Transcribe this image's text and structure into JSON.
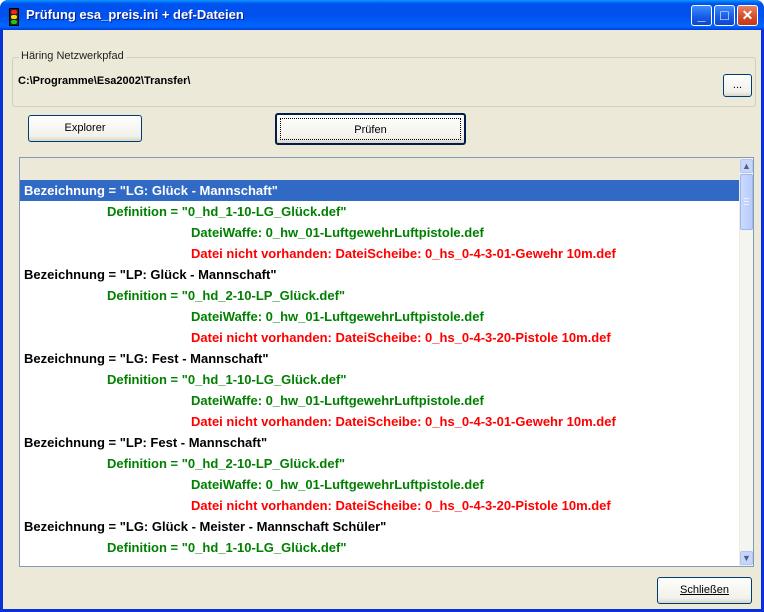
{
  "window": {
    "title": "Prüfung esa_preis.ini + def-Dateien"
  },
  "titlebar_buttons": {
    "minimize": "_",
    "maximize": "□",
    "close": "✕"
  },
  "path_group": {
    "legend": "Häring Netzwerkpfad",
    "path": "C:\\Programme\\Esa2002\\Transfer\\",
    "browse_label": "..."
  },
  "buttons": {
    "explorer": "Explorer",
    "pruefen": "Prüfen",
    "schliessen": "Schließen"
  },
  "list": {
    "selected_index": 0,
    "rows": [
      {
        "level": 0,
        "type": "bezeichnung",
        "text": "Bezeichnung = \"LG: Glück - Mannschaft\""
      },
      {
        "level": 1,
        "type": "definition",
        "text": "Definition = \"0_hd_1-10-LG_Glück.def\""
      },
      {
        "level": 2,
        "type": "ok",
        "text": "DateiWaffe: 0_hw_01-LuftgewehrLuftpistole.def"
      },
      {
        "level": 2,
        "type": "error",
        "text": "Datei nicht vorhanden: DateiScheibe: 0_hs_0-4-3-01-Gewehr 10m.def"
      },
      {
        "level": 0,
        "type": "bezeichnung",
        "text": "Bezeichnung = \"LP: Glück - Mannschaft\""
      },
      {
        "level": 1,
        "type": "definition",
        "text": "Definition = \"0_hd_2-10-LP_Glück.def\""
      },
      {
        "level": 2,
        "type": "ok",
        "text": "DateiWaffe: 0_hw_01-LuftgewehrLuftpistole.def"
      },
      {
        "level": 2,
        "type": "error",
        "text": "Datei nicht vorhanden: DateiScheibe: 0_hs_0-4-3-20-Pistole 10m.def"
      },
      {
        "level": 0,
        "type": "bezeichnung",
        "text": "Bezeichnung = \"LG: Fest - Mannschaft\""
      },
      {
        "level": 1,
        "type": "definition",
        "text": "Definition = \"0_hd_1-10-LG_Glück.def\""
      },
      {
        "level": 2,
        "type": "ok",
        "text": "DateiWaffe: 0_hw_01-LuftgewehrLuftpistole.def"
      },
      {
        "level": 2,
        "type": "error",
        "text": "Datei nicht vorhanden: DateiScheibe: 0_hs_0-4-3-01-Gewehr 10m.def"
      },
      {
        "level": 0,
        "type": "bezeichnung",
        "text": "Bezeichnung = \"LP: Fest - Mannschaft\""
      },
      {
        "level": 1,
        "type": "definition",
        "text": "Definition = \"0_hd_2-10-LP_Glück.def\""
      },
      {
        "level": 2,
        "type": "ok",
        "text": "DateiWaffe: 0_hw_01-LuftgewehrLuftpistole.def"
      },
      {
        "level": 2,
        "type": "error",
        "text": "Datei nicht vorhanden: DateiScheibe: 0_hs_0-4-3-20-Pistole 10m.def"
      },
      {
        "level": 0,
        "type": "bezeichnung",
        "text": "Bezeichnung = \"LG: Glück - Meister - Mannschaft Schüler\""
      },
      {
        "level": 1,
        "type": "definition",
        "text": "Definition = \"0_hd_1-10-LG_Glück.def\""
      }
    ]
  },
  "scrollbar": {
    "up_icon": "chevron-up-icon",
    "down_icon": "chevron-down-icon"
  },
  "colors": {
    "selection": "#316ac5",
    "ok_text": "#008000",
    "error_text": "#ff0000",
    "titlebar": "#0054e3"
  }
}
